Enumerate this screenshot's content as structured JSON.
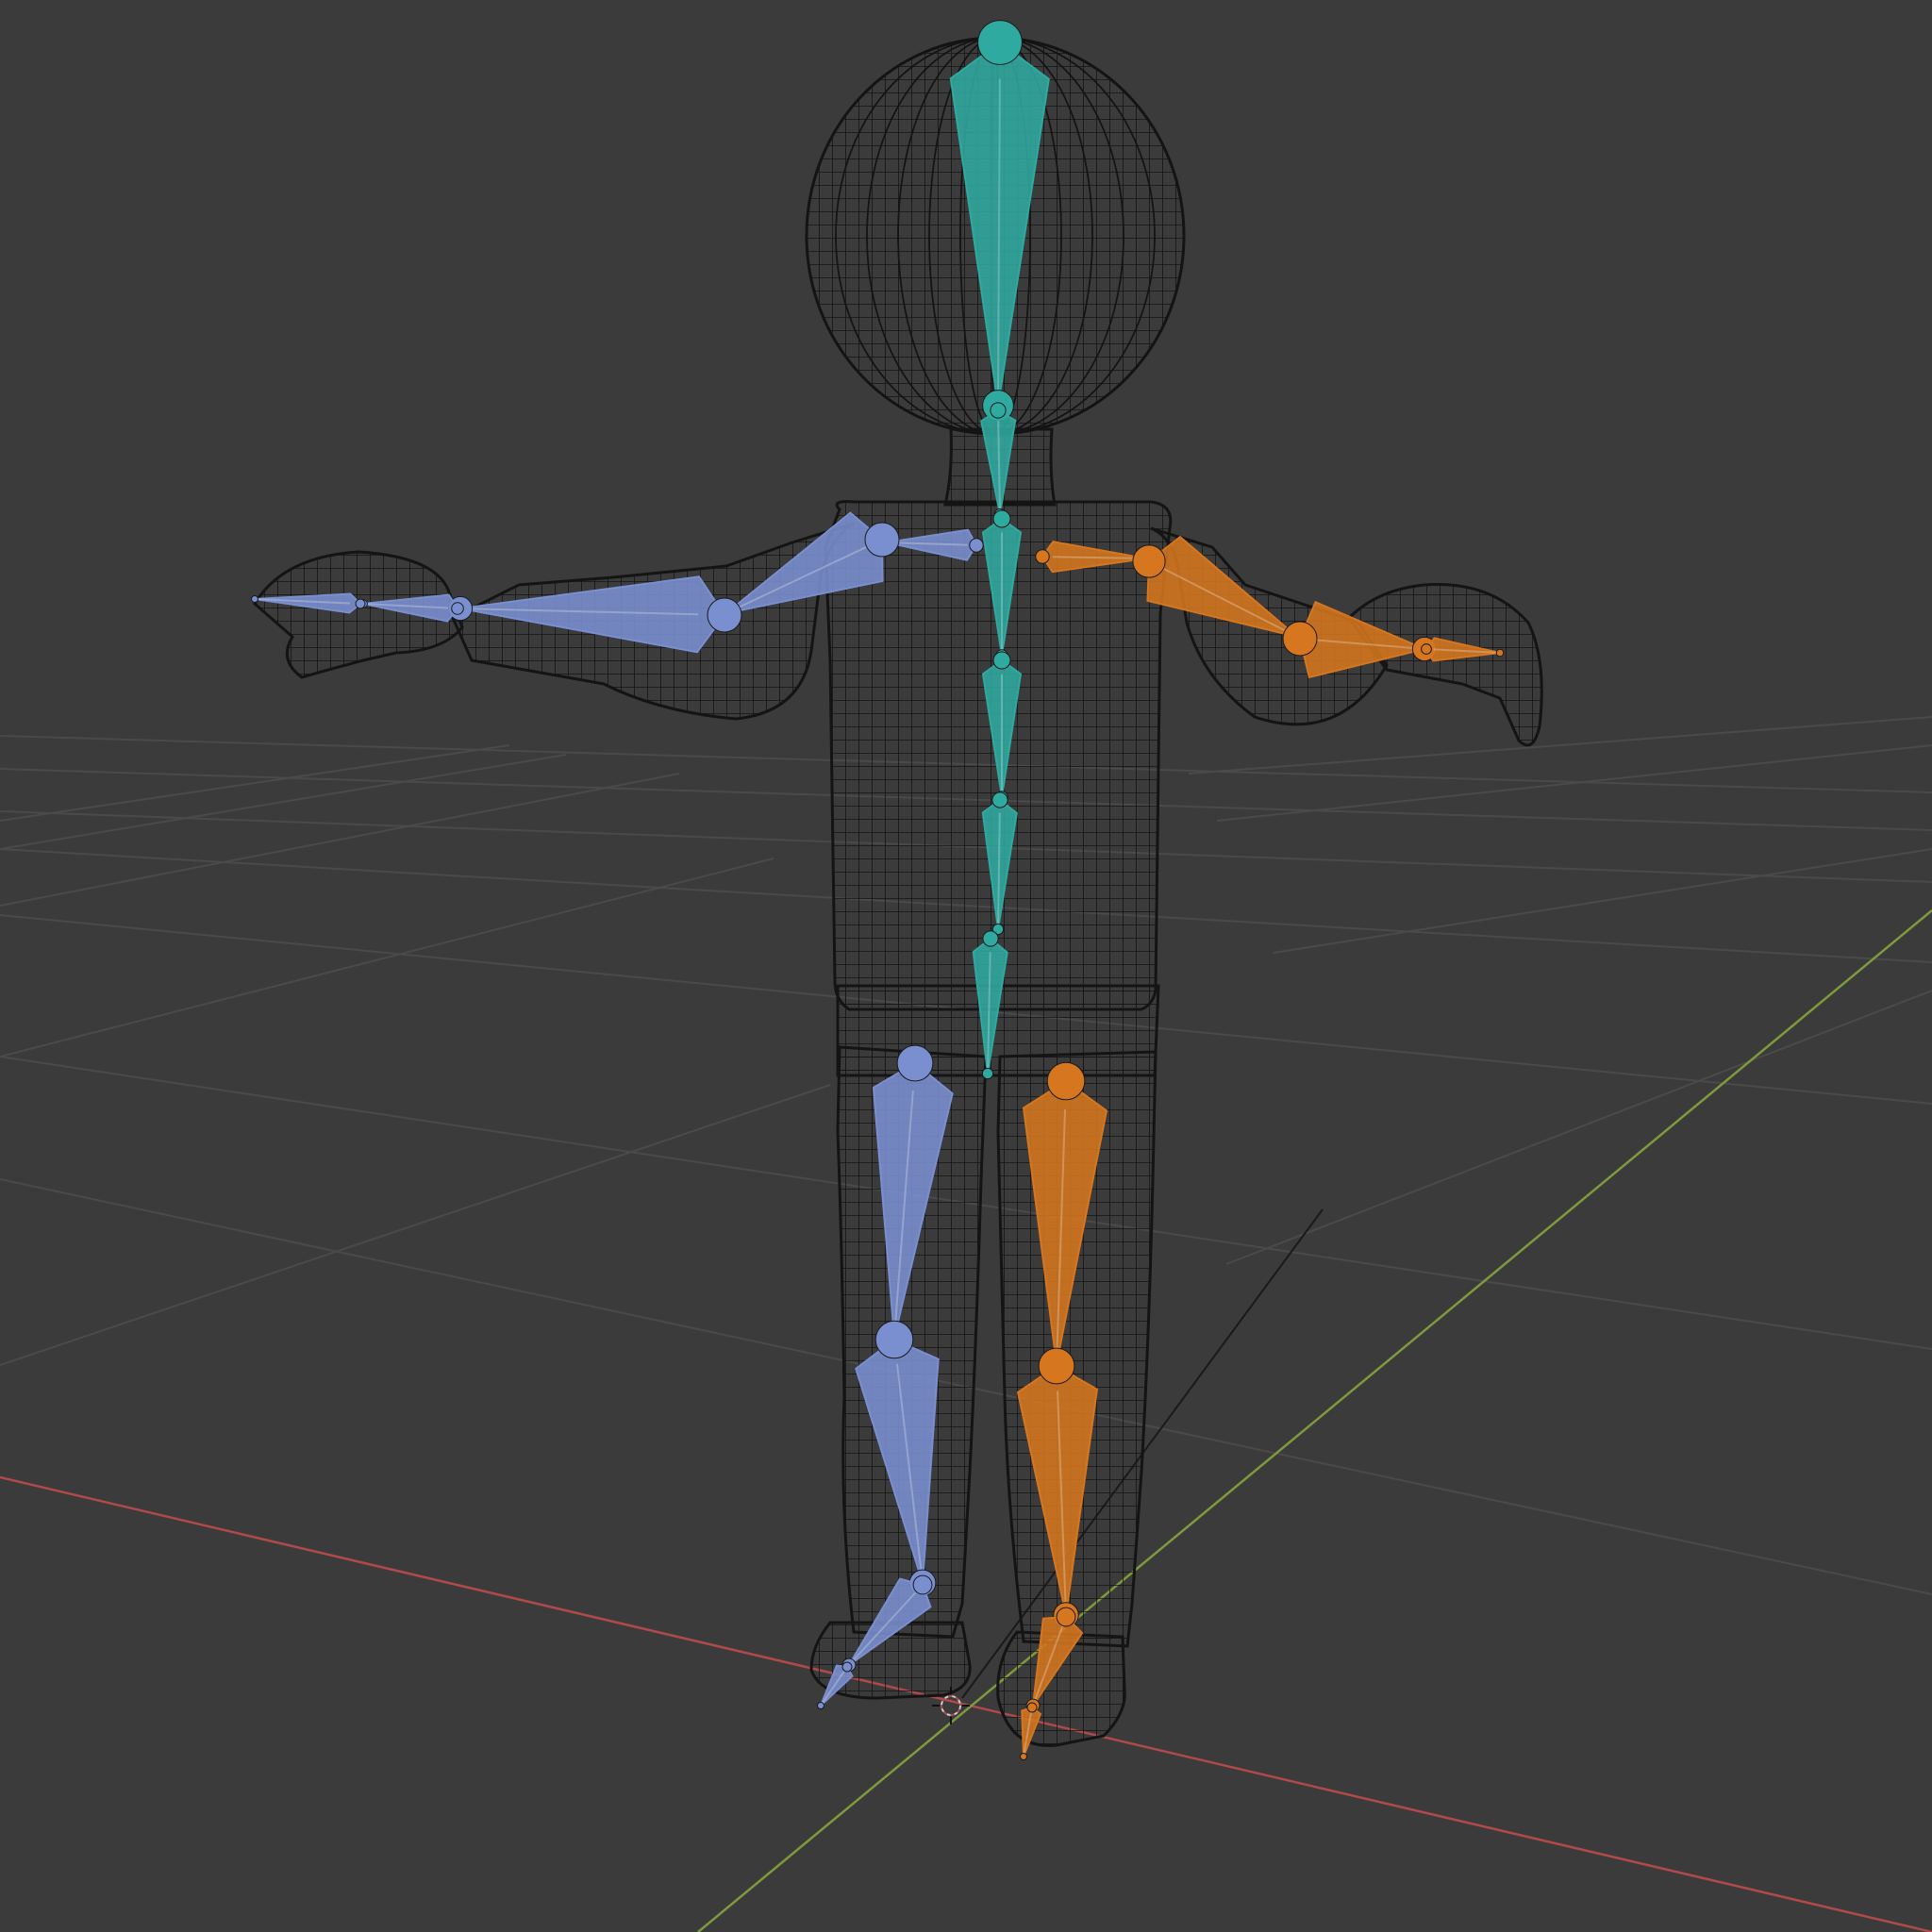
{
  "viewport": {
    "background": "#3b3b3b",
    "grid_color": "#4a4a4a",
    "x_axis_color": "#b04a4a",
    "y_axis_color": "#7e9a3c",
    "wire_color": "#141414"
  },
  "armature": {
    "center_bone_color": "#2faaa0",
    "left_bone_color": "#7a8fd0",
    "right_bone_color": "#d6761f"
  },
  "objects": [
    {
      "name": "wireframe-body",
      "type": "mesh"
    },
    {
      "name": "armature",
      "type": "armature"
    },
    {
      "name": "3d-cursor",
      "type": "cursor"
    }
  ]
}
